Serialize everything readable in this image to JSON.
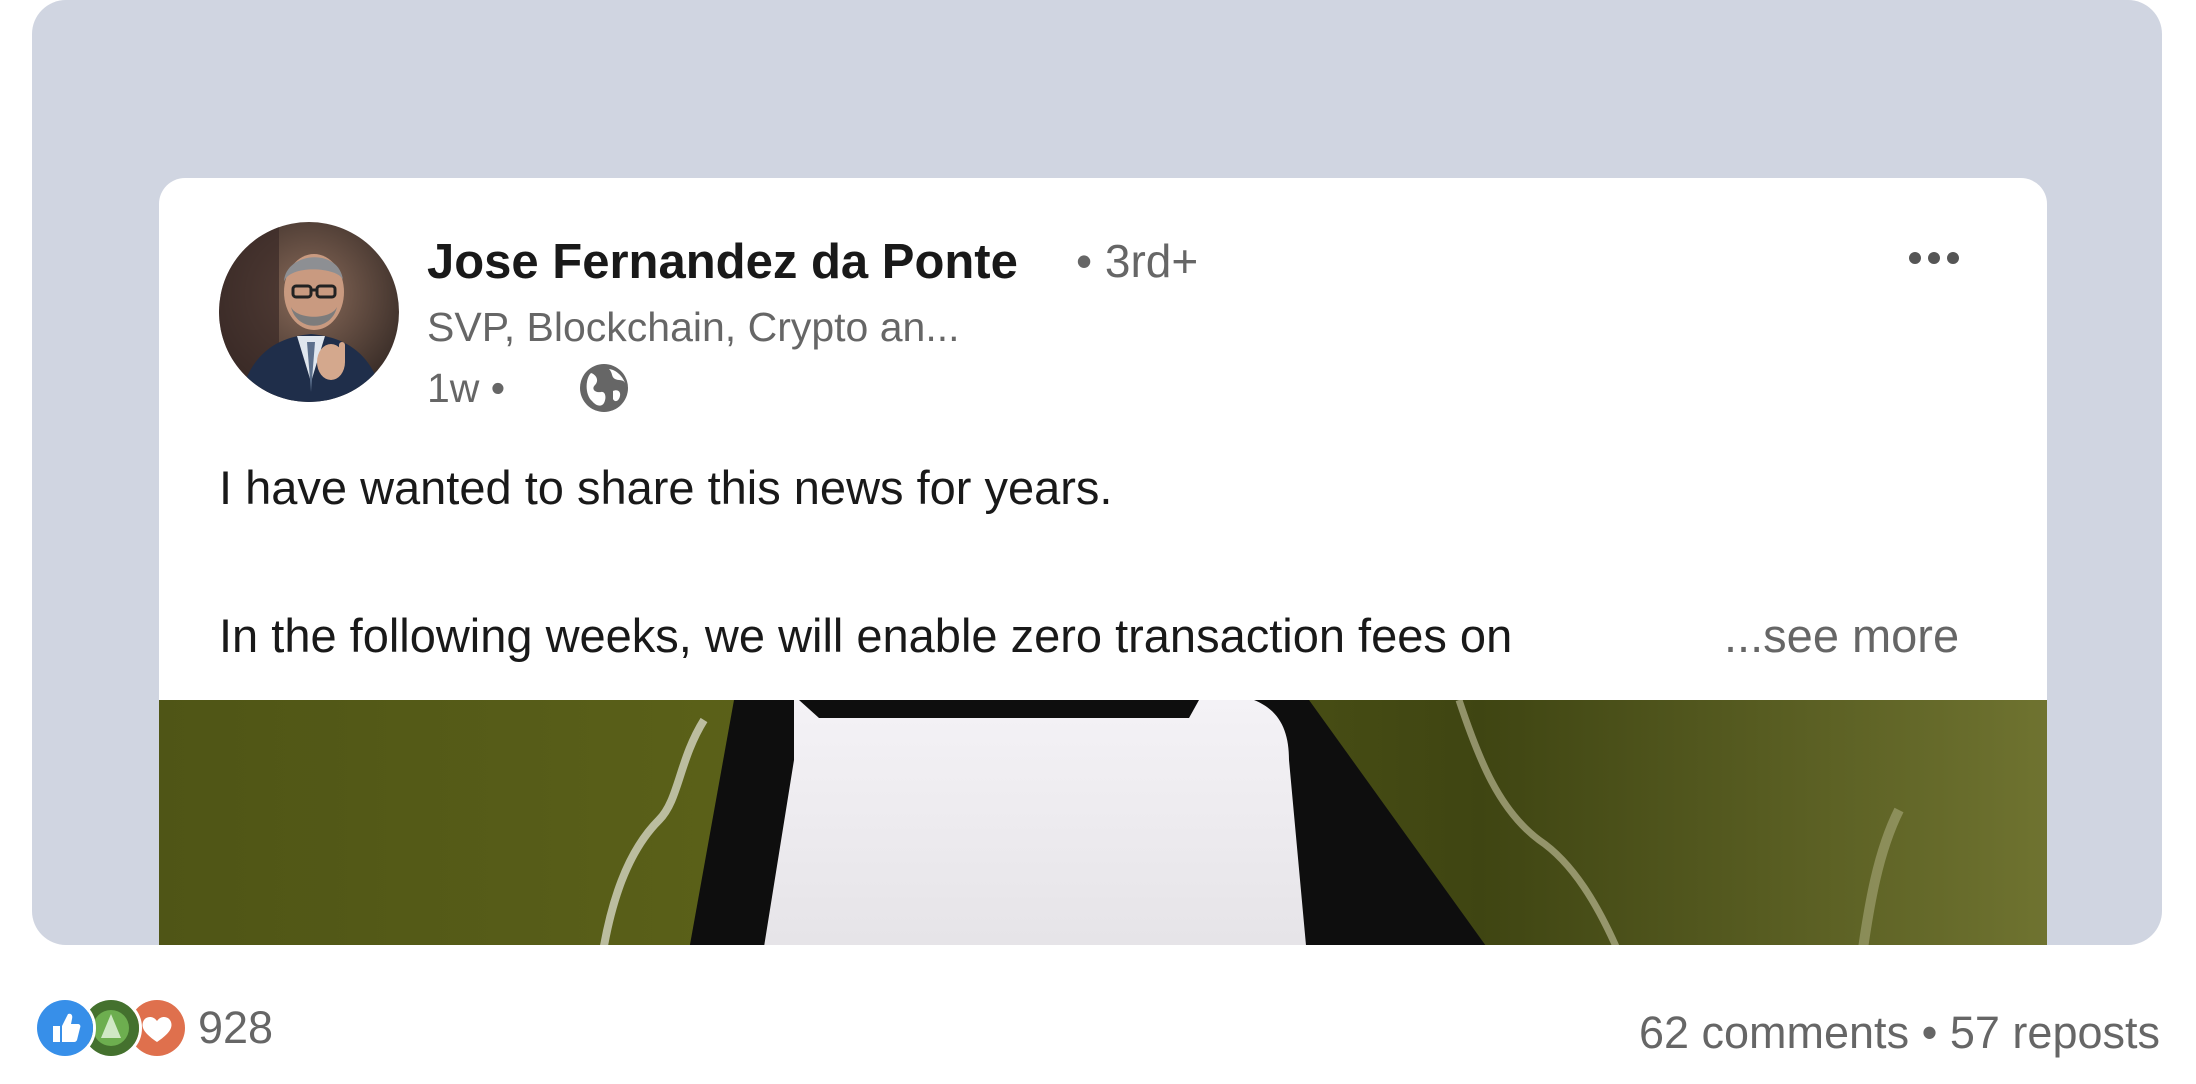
{
  "post": {
    "author_name": "Jose Fernandez da Ponte",
    "connection_degree": "• 3rd+",
    "headline": "SVP, Blockchain, Crypto an...",
    "time": "1w •",
    "visibility_icon": "globe-icon",
    "more_icon": "more-horizontal-icon",
    "text_line_1": "I have wanted to share this news for years.",
    "text_line_2": "In the following weeks, we will enable zero transaction fees on",
    "see_more_label": "...see more"
  },
  "social": {
    "reaction_icons": [
      "like-icon",
      "celebrate-icon",
      "love-icon"
    ],
    "reaction_count": "928",
    "comments_label": "62 comments",
    "separator": "•",
    "reposts_label": "57 reposts"
  },
  "colors": {
    "frame_bg": "#d0d5e1",
    "card_bg": "#ffffff",
    "like": "#378fe9",
    "celebrate": "#44712e",
    "love": "#df704d"
  }
}
